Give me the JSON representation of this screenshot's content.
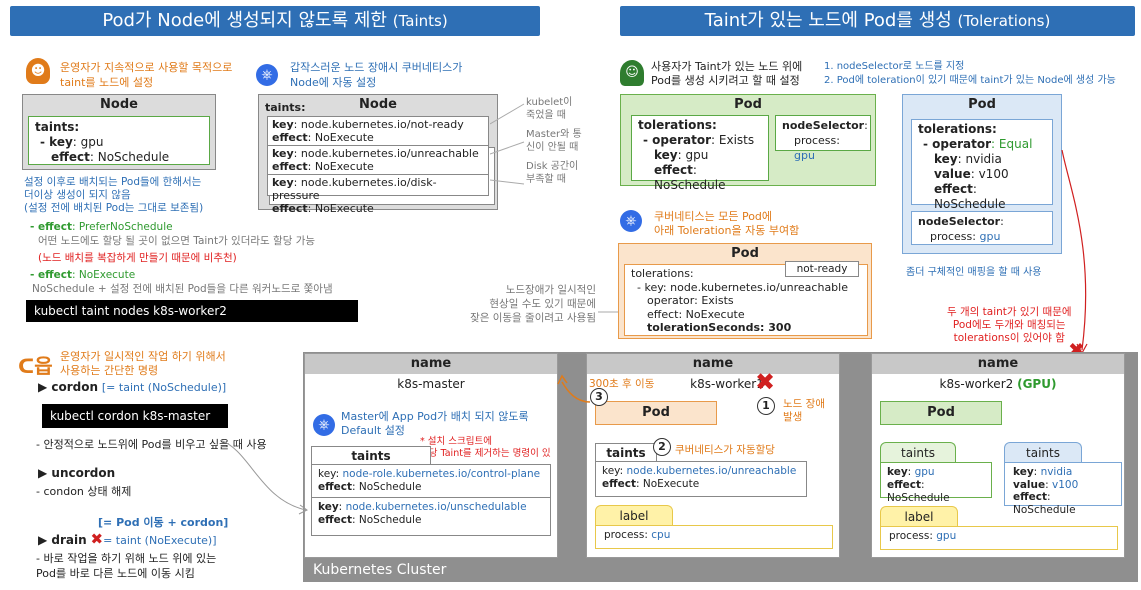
{
  "left_banner": {
    "main": "Pod가 Node에 생성되지 않도록 제한",
    "sub": "(Taints)"
  },
  "right_banner": {
    "main": "Taint가 있는 노드에 Pod를 생성",
    "sub": "(Tolerations)"
  },
  "operator_note": [
    "운영자가 지속적으로 사용할 목적으로",
    "taint를 노드에 설정"
  ],
  "auto_note": [
    "갑작스러운 노드 장애시 쿠버네티스가",
    "Node에 자동 설정"
  ],
  "node1": {
    "title": "Node",
    "taints_label": "taints:",
    "key_label": "- key",
    "key_value": ": gpu",
    "effect_label": "effect",
    "effect_value": ": NoSchedule"
  },
  "node2": {
    "title": "Node",
    "taints_label": "taints:",
    "entries": [
      {
        "key": "node.kubernetes.io/not-ready",
        "effect": "NoExecute"
      },
      {
        "key": "node.kubernetes.io/unreachable",
        "effect": "NoExecute"
      },
      {
        "key": "node.kubernetes.io/disk-pressure",
        "effect": "NoExecute"
      }
    ],
    "notes": [
      "kubelet이",
      "죽었을 때",
      "Master와 통",
      "신이 안될 때",
      "Disk 공간이",
      "부족할 때"
    ]
  },
  "taint_desc": [
    "설정 이후로 배치되는 Pod들에 한해서는",
    "더이상 생성이 되지 않음",
    "(설정 전에 배치된 Pod는 그대로 보존됨)"
  ],
  "prefer": {
    "label": "- effect",
    "value": ": PreferNoSchedule",
    "desc": "어떤 노드에도 할당 될 곳이 없으면 Taint가 있더라도 할당 가능",
    "warn": "(노드 배치를 복잡하게 만들기 때문에 비추천)"
  },
  "noexec": {
    "label": "- effect",
    "value": ": NoExecute",
    "desc": "NoSchedule + 설정 전에 배치된 Pod들을 다른 워커노드로 쫓아냄"
  },
  "cmd_taint": "kubectl taint nodes k8s-worker2 key=gpu:NoSchedule",
  "cordon_note": [
    "운영자가 일시적인 작업 하기 위해서",
    "사용하는 간단한 명령"
  ],
  "cordon": {
    "label": "▶ cordon",
    "eq": "[= taint (NoSchedule)]",
    "cmd": "kubectl cordon k8s-master",
    "desc": "- 안정적으로 노드위에 Pod를 비우고 싶을 때 사용"
  },
  "uncordon": {
    "label": "▶ uncordon",
    "desc": "- condon 상태 해제"
  },
  "drain": {
    "top": "[= Pod 이동 + cordon]",
    "label": "▶ drain",
    "eq": "= taint (NoExecute)]",
    "desc1": "- 바로 작업을 하기 위해 노드 위에 있는",
    "desc2": "Pod를 바로 다른 노드에 이동 시킴"
  },
  "user_note": [
    "사용자가 Taint가 있는 노드 위에",
    "Pod를 생성 시키려고 할 때 설정"
  ],
  "steps_note": [
    "1. nodeSelector로 노드를 지정",
    "2. Pod에 toleration이 있기 때문에 taint가 있는 Node에 생성 가능"
  ],
  "pod1": {
    "title": "Pod",
    "tol": "tolerations:",
    "op_label": "- operator",
    "op_value": ": Exists",
    "key_label": "key",
    "key_value": ": gpu",
    "eff_label": "effect",
    "eff_value": ": NoSchedule",
    "ns_label": "nodeSelector",
    "ns_colon": ":",
    "proc_label": "process",
    "proc_value": "gpu"
  },
  "pod2": {
    "title": "Pod",
    "tol": "tolerations:",
    "op_label": "- operator",
    "op_value": ": Equal",
    "key_label": "key",
    "key_value": ": nvidia",
    "val_label": "value",
    "val_value": ": v100",
    "eff_label": "effect",
    "eff_value": ": NoSchedule",
    "ns_label": "nodeSelector",
    "ns_colon": ":",
    "proc_label": "process",
    "proc_value": "gpu",
    "note": "좀더 구체적인 매핑을 할 때 사용"
  },
  "auto_tol_note": [
    "쿠버네티스는 모든 Pod에",
    "아래 Toleration을 자동 부여함"
  ],
  "pod3": {
    "title": "Pod",
    "badge": "not-ready",
    "lines": [
      "tolerations:",
      "- key: node.kubernetes.io/unreachable",
      "operator: Exists",
      "effect: NoExecute"
    ],
    "sec_label": "tolerationSeconds",
    "sec_value": ": 300"
  },
  "wait_note": [
    "노드장애가 일시적인",
    "현상일 수도 있기 때문에",
    "잦은 이동을 줄이려고 사용됨"
  ],
  "two_taint_note": [
    "두 개의 taint가 있기 때문에",
    "Pod에도 두개와 매칭되는",
    "tolerations이 있어야 함"
  ],
  "cluster": {
    "label": "Kubernetes Cluster",
    "master": {
      "hdr": "name",
      "name": "k8s-master",
      "note": [
        "Master에 App Pod가 배치 되지 않도록",
        "Default 설정"
      ],
      "star": [
        "* 설치 스크립트에",
        "해당 Taint를 제거하는 명령이 있음"
      ],
      "taints": "taints",
      "t1_key": "node-role.kubernetes.io/control-plane",
      "t1_eff": "NoSchedule",
      "t2_key": "node.kubernetes.io/unschedulable",
      "t2_eff": "NoSchedule"
    },
    "worker1": {
      "hdr": "name",
      "name": "k8s-worker1",
      "move": "300초 후 이동",
      "fail": [
        "노드 장애",
        "발생"
      ],
      "pod": "Pod",
      "taints": "taints",
      "auto": "쿠버네티스가 자동할당",
      "t_key": "node.kubernetes.io/unreachable",
      "t_eff": "NoExecute",
      "label": "label",
      "proc_label": "process",
      "proc_value": "cpu"
    },
    "worker2": {
      "hdr": "name",
      "name": "k8s-worker2",
      "gpu": "(GPU)",
      "pod": "Pod",
      "taints": "taints",
      "ta_key": "gpu",
      "ta_eff": "NoSchedule",
      "tb_key": "nvidia",
      "tb_val": "v100",
      "tb_eff": "NoSchedule",
      "label": "label",
      "proc_label": "process",
      "proc_value": "gpu"
    }
  },
  "kv": {
    "key": "key",
    "effect": "effect",
    "value": "value",
    "colon": ":",
    "k8s_glyph": "⎈"
  },
  "steps": {
    "one": "1",
    "two": "2",
    "three": "3"
  },
  "icon_glyphs": {
    "mark": "ᑕ읍"
  }
}
